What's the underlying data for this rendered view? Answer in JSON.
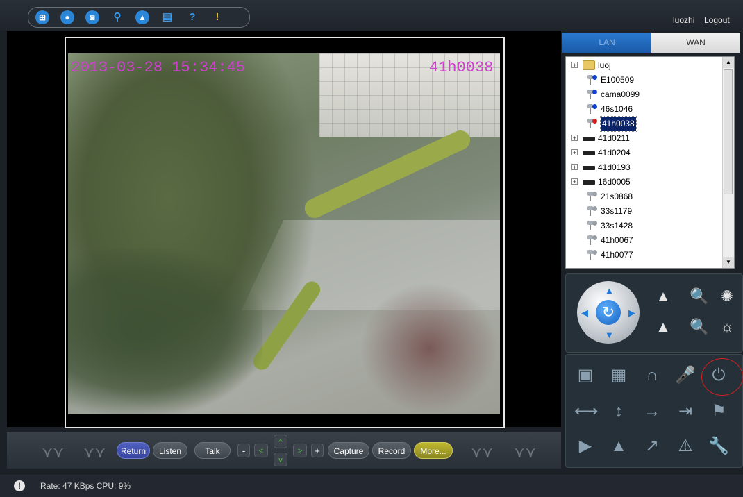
{
  "header": {
    "toolbar_icons": [
      "grid-icon",
      "record-icon",
      "camera-icon",
      "search-icon",
      "lock-icon",
      "save-icon",
      "help-icon",
      "info-icon"
    ],
    "username": "luozhi",
    "logout_label": "Logout"
  },
  "video": {
    "osd_datetime": "2013-03-28 15:34:45",
    "osd_camera": "41h0038"
  },
  "controls": {
    "return": "Return",
    "listen": "Listen",
    "talk": "Talk",
    "minus": "-",
    "plus": "+",
    "capture": "Capture",
    "record": "Record",
    "more": "More..."
  },
  "status": {
    "text": "Rate: 47 KBps  CPU:  9%"
  },
  "tabs": {
    "lan": "LAN",
    "wan": "WAN"
  },
  "tree": {
    "items": [
      {
        "label": "luoj",
        "type": "folder",
        "expander": "+"
      },
      {
        "label": "E100509",
        "type": "camera",
        "dot": "#1040d0"
      },
      {
        "label": "cama0099",
        "type": "camera",
        "dot": "#1040d0"
      },
      {
        "label": "46s1046",
        "type": "camera",
        "dot": "#1040d0"
      },
      {
        "label": "41h0038",
        "type": "camera",
        "dot": "#d02020",
        "selected": true
      },
      {
        "label": "41d0211",
        "type": "dvr",
        "expander": "+"
      },
      {
        "label": "41d0204",
        "type": "dvr",
        "expander": "+"
      },
      {
        "label": "41d0193",
        "type": "dvr",
        "expander": "+"
      },
      {
        "label": "16d0005",
        "type": "dvr",
        "expander": "+"
      },
      {
        "label": "21s0868",
        "type": "camera",
        "dot": "#9aa0a6"
      },
      {
        "label": "33s1179",
        "type": "camera",
        "dot": "#9aa0a6"
      },
      {
        "label": "33s1428",
        "type": "camera",
        "dot": "#9aa0a6"
      },
      {
        "label": "41h0067",
        "type": "camera",
        "dot": "#9aa0a6"
      },
      {
        "label": "41h0077",
        "type": "camera",
        "dot": "#9aa0a6"
      }
    ]
  },
  "colors": {
    "accent": "#2b86d8",
    "selected": "#0a246a",
    "osd": "#d040d0"
  }
}
